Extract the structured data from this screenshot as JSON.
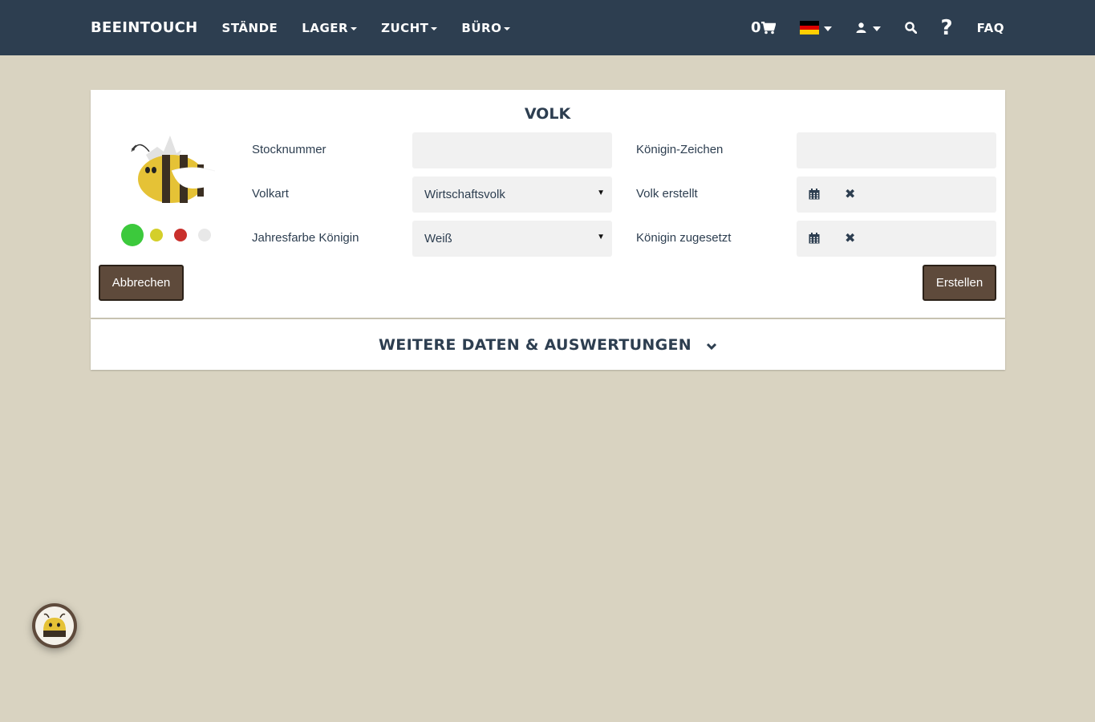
{
  "nav": {
    "brand": "BEEINTOUCH",
    "items": [
      {
        "label": "STÄNDE",
        "dropdown": false
      },
      {
        "label": "LAGER",
        "dropdown": true
      },
      {
        "label": "ZUCHT",
        "dropdown": true
      },
      {
        "label": "BÜRO",
        "dropdown": true
      }
    ],
    "cart_count": "0",
    "faq": "FAQ",
    "help": "?",
    "icons": [
      "cart-icon",
      "flag-de-icon",
      "user-icon",
      "search-icon",
      "help-icon"
    ]
  },
  "form": {
    "title": "VOLK",
    "stocknummer_label": "Stocknummer",
    "stocknummer_value": "",
    "volkart_label": "Volkart",
    "volkart_value": "Wirtschaftsvolk",
    "jahresfarbe_label": "Jahresfarbe Königin",
    "jahresfarbe_value": "Weiß",
    "koenigin_zeichen_label": "Königin-Zeichen",
    "koenigin_zeichen_value": "",
    "volk_erstellt_label": "Volk erstellt",
    "koenigin_zugesetzt_label": "Königin zugesetzt",
    "status_colors": [
      "#3cc93c",
      "#d4cf2a",
      "#c9302c",
      "#e8e8e8"
    ]
  },
  "buttons": {
    "cancel": "Abbrechen",
    "create": "Erstellen"
  },
  "more": {
    "title": "WEITERE DATEN & AUSWERTUNGEN"
  },
  "colors": {
    "navbar": "#2d3e50",
    "background": "#d9d3c1",
    "button": "#5e4a3b"
  }
}
